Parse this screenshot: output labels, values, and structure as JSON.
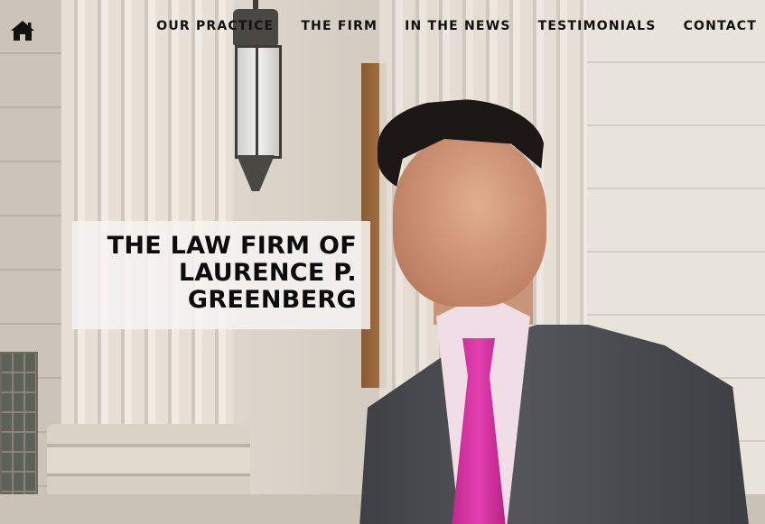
{
  "nav": {
    "home_icon": "home-icon",
    "links": [
      "OUR PRACTICE",
      "THE FIRM",
      "IN THE NEWS",
      "TESTIMONIALS",
      "CONTACT"
    ]
  },
  "hero": {
    "title_lines": [
      "THE LAW FIRM OF",
      "LAURENCE P.",
      "GREENBERG"
    ]
  },
  "colors": {
    "nav_text": "#111111",
    "title_text": "#0c0c0c",
    "title_box_bg": "#f5f3f0",
    "tie_accent": "#e33fb0"
  }
}
